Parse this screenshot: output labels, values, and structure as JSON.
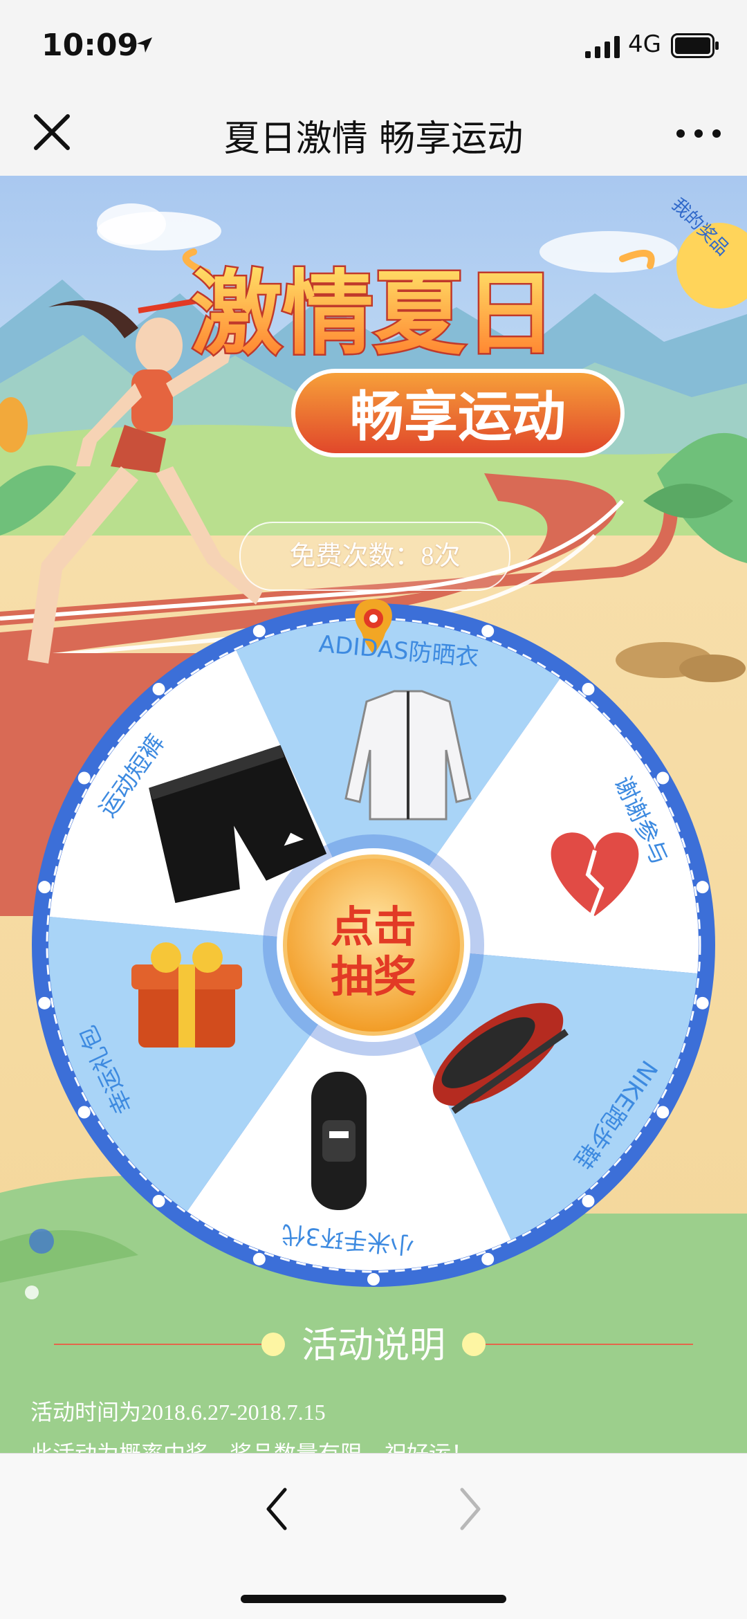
{
  "status_bar": {
    "time": "10:09",
    "network": "4G",
    "icons": [
      "location-arrow-icon",
      "signal-bars-icon",
      "battery-icon"
    ]
  },
  "nav": {
    "title": "夏日激情 畅享运动",
    "close_icon": "close-icon",
    "more_icon": "more-dots-icon"
  },
  "banner": {
    "title_line1": "激情夏日",
    "title_line2": "畅享运动",
    "my_prizes": "我的奖品"
  },
  "free_count": "免费次数：8次",
  "wheel": {
    "center_line1": "点击",
    "center_line2": "抽奖",
    "prizes": [
      {
        "label": "ADIDAS防晒衣",
        "icon": "jacket-icon"
      },
      {
        "label": "谢谢参与",
        "icon": "broken-heart-icon"
      },
      {
        "label": "NIKE跑步鞋",
        "icon": "sneakers-icon"
      },
      {
        "label": "小米手环3代",
        "icon": "smart-band-icon"
      },
      {
        "label": "幸运礼包",
        "icon": "gift-box-icon"
      },
      {
        "label": "运动短裤",
        "icon": "shorts-icon"
      }
    ]
  },
  "rules": {
    "title": "活动说明",
    "lines": [
      "活动时间为2018.6.27-2018.7.15",
      "此活动为概率中奖，奖品数量有限，祝好运！"
    ]
  },
  "toolbar": {
    "back_icon": "chevron-left-icon",
    "forward_icon": "chevron-right-icon"
  },
  "colors": {
    "wheel_blue": "#3c6fd8",
    "segment_blue": "#a9d4f7",
    "grass_green": "#9ccf8c",
    "track_red": "#d96a55",
    "center_orange": "#f5a430",
    "label_blue": "#3d8ae0"
  }
}
